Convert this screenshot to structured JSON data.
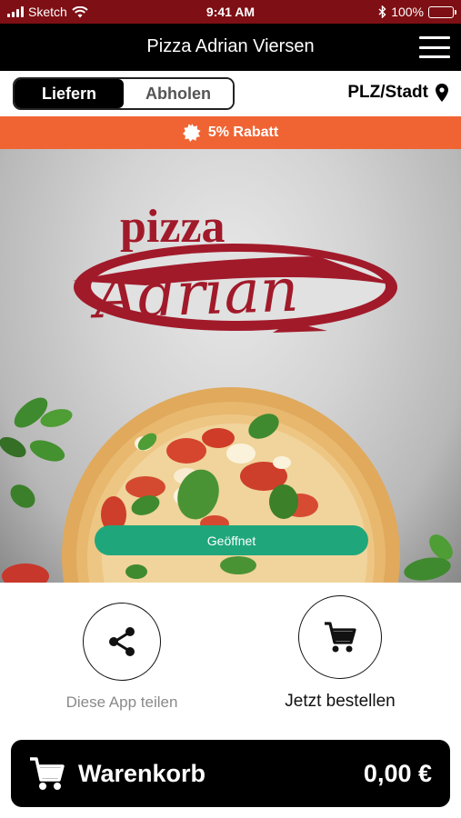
{
  "status_bar": {
    "carrier": "Sketch",
    "time": "9:41 AM",
    "battery": "100%"
  },
  "header": {
    "title": "Pizza Adrian Viersen"
  },
  "mode_toggle": {
    "options": [
      "Liefern",
      "Abholen"
    ],
    "selected": "Liefern"
  },
  "location": {
    "label": "PLZ/Stadt"
  },
  "discount": {
    "text": "5% Rabatt"
  },
  "hero": {
    "logo_top": "pizza",
    "logo_main": "Adrian",
    "status": "Geöffnet"
  },
  "actions": {
    "share_label": "Diese App teilen",
    "order_label": "Jetzt bestellen"
  },
  "cart": {
    "label": "Warenkorb",
    "total": "0,00 €"
  },
  "colors": {
    "status_bar": "#7e0f14",
    "discount": "#f06433",
    "open": "#1fa77b",
    "logo": "#a11a2a"
  }
}
